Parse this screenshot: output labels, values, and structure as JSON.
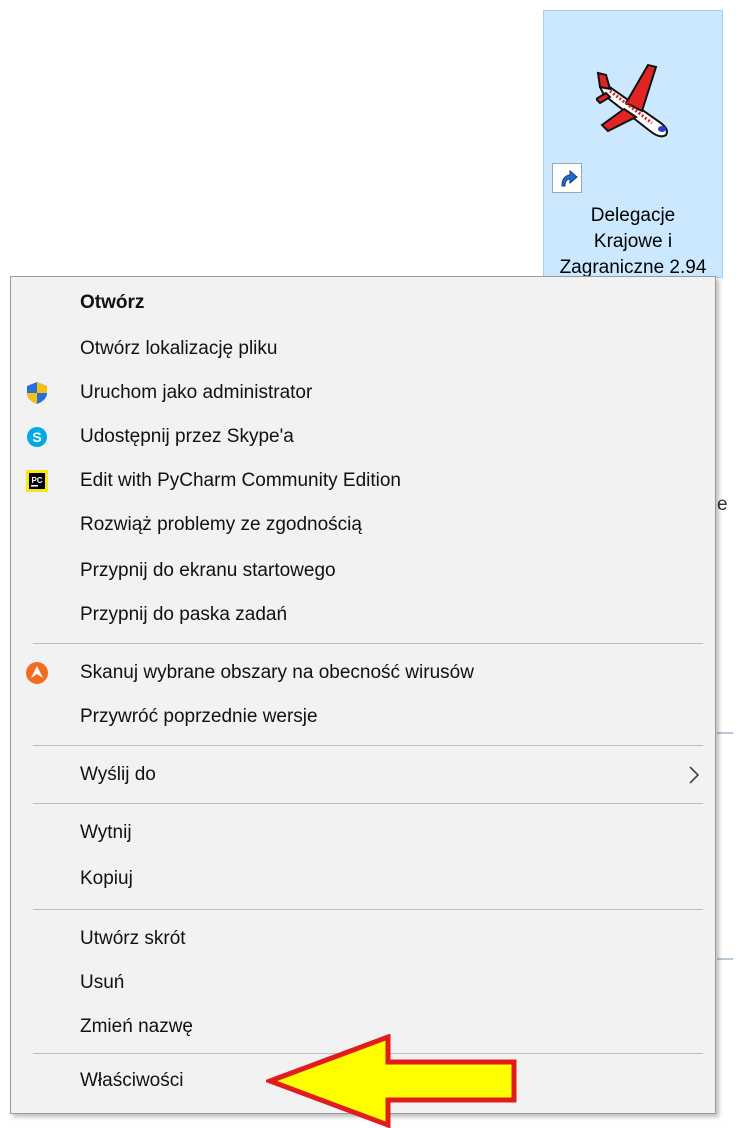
{
  "desktop_icon": {
    "label_lines": [
      "Delegacje",
      "Krajowe i",
      "Zagraniczne 2.94"
    ],
    "icon": "airplane-icon",
    "overlay": "shortcut-arrow-icon",
    "background_color": "#cce8ff"
  },
  "background_window": {
    "partial_text": "e"
  },
  "context_menu": {
    "items": [
      {
        "label": "Otwórz",
        "bold": true
      },
      {
        "label": "Otwórz lokalizację pliku"
      },
      {
        "label": "Uruchom jako administrator",
        "icon": "uac-shield-icon"
      },
      {
        "label": "Udostępnij przez Skype'a",
        "icon": "skype-icon"
      },
      {
        "label": "Edit with PyCharm Community Edition",
        "icon": "pycharm-icon"
      },
      {
        "label": "Rozwiąż problemy ze zgodnością"
      },
      {
        "label": "Przypnij do ekranu startowego"
      },
      {
        "label": "Przypnij do paska zadań"
      },
      {
        "label": "Skanuj wybrane obszary na obecność wirusów",
        "icon": "avast-icon"
      },
      {
        "label": "Przywróć poprzednie wersje"
      },
      {
        "label": "Wyślij do",
        "submenu": true
      },
      {
        "label": "Wytnij"
      },
      {
        "label": "Kopiuj"
      },
      {
        "label": "Utwórz skrót"
      },
      {
        "label": "Usuń"
      },
      {
        "label": "Zmień nazwę"
      },
      {
        "label": "Właściwości"
      }
    ]
  },
  "annotation": {
    "type": "arrow",
    "color": "#ffff00",
    "outline_color": "#e21b1b"
  }
}
